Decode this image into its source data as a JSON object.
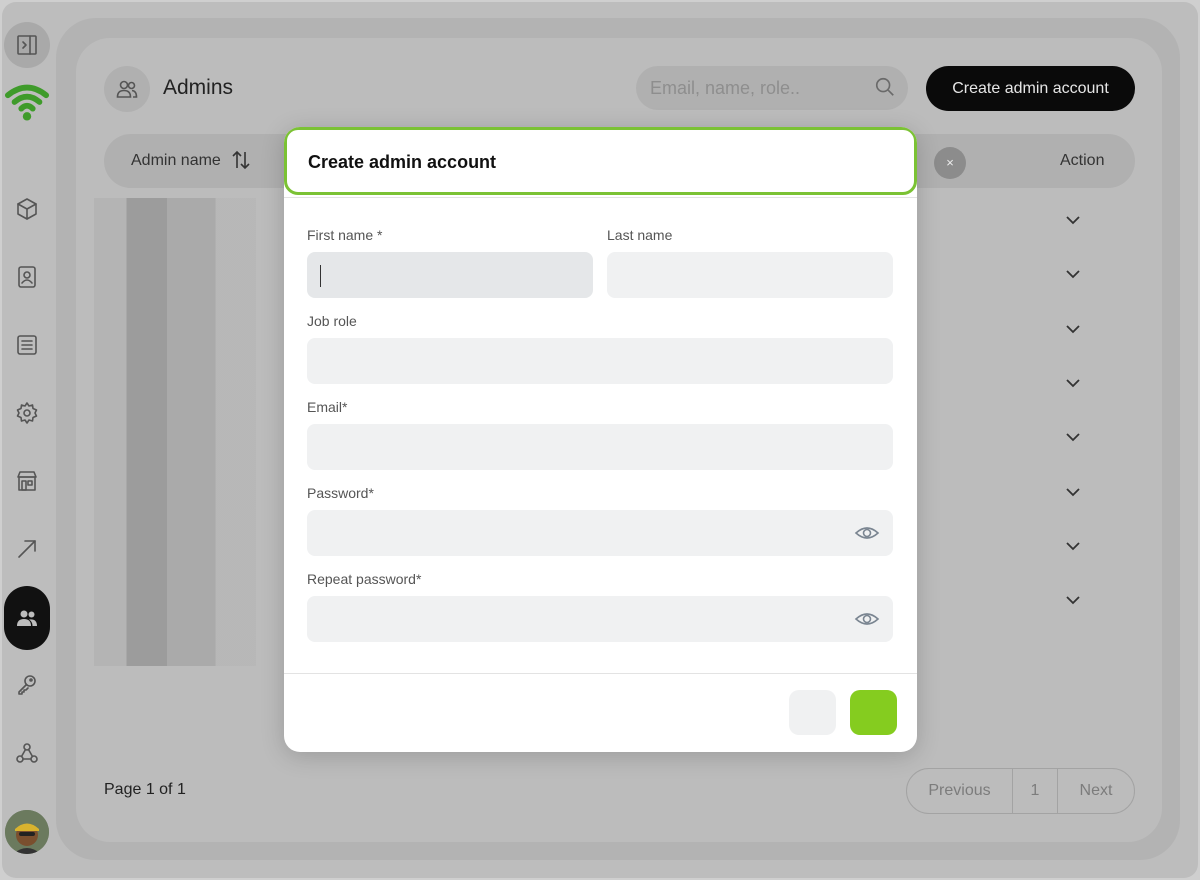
{
  "page": {
    "title": "Admins",
    "search_placeholder": "Email, name, role..",
    "create_button": "Create admin account",
    "page_count": "Page 1 of 1"
  },
  "table": {
    "columns": [
      "Admin name",
      "Action"
    ],
    "row_count": 8
  },
  "pagination": {
    "previous": "Previous",
    "current": "1",
    "next": "Next"
  },
  "sidebar": {
    "items": [
      "sidebar-toggle",
      "logo",
      "products",
      "contacts",
      "documents",
      "settings",
      "store",
      "trending",
      "admins",
      "keys",
      "webhooks"
    ],
    "active": "admins"
  },
  "modal": {
    "title": "Create admin account",
    "first_name_label": "First name *",
    "last_name_label": "Last name",
    "job_role_label": "Job role",
    "email_label": "Email*",
    "password_label": "Password*",
    "repeat_password_label": "Repeat password*",
    "clear_label": "×"
  },
  "colors": {
    "accent": "#85cc1f",
    "header_border": "#7bc234",
    "logo": "#3f9b2b"
  }
}
